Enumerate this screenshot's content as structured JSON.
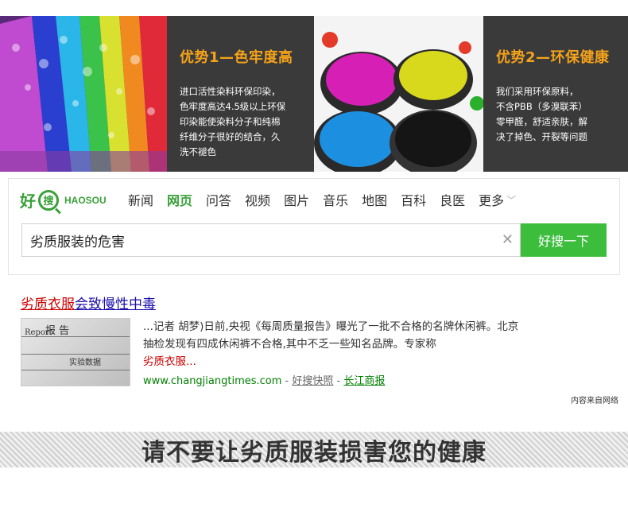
{
  "banner": {
    "panel1": {
      "title": "优势1—色牢度高",
      "body": "进口活性染料环保印染，\n色牢度高达4.5级以上环保\n印染能使染料分子和纯棉\n纤维分子很好的结合，久\n洗不褪色"
    },
    "panel2": {
      "title": "优势2—环保健康",
      "body": "我们采用环保原料，\n不含PBB（多溴联苯）\n零甲醛，舒适亲肤，解\n决了掉色、开裂等问题"
    }
  },
  "search": {
    "logo": {
      "han": "好",
      "circle": "搜",
      "en": "HAOSOU"
    },
    "nav": [
      "新闻",
      "网页",
      "问答",
      "视频",
      "图片",
      "音乐",
      "地图",
      "百科",
      "良医"
    ],
    "nav_active": "网页",
    "nav_more": "更多",
    "query": "劣质服装的危害",
    "button": "好搜一下"
  },
  "result": {
    "title_red": "劣质衣服",
    "title_blue": "会致慢性中毒",
    "thumb_texts": [
      "报  告",
      "Report",
      "实验数据"
    ],
    "snippet": "...记者 胡梦)日前,央视《每周质量报告》曝光了一批不合格的名牌休闲裤。北京抽检发现有四成休闲裤不合格,其中不乏一些知名品牌。专家称",
    "snippet_red": "劣质衣服...",
    "url": "www.changjiangtimes.com",
    "sep1": " - ",
    "cache": "好搜快照",
    "sep2": " - ",
    "source": "长江商报",
    "note": "内容来自网络"
  },
  "slogan": "请不要让劣质服装损害您的健康",
  "colors": {
    "brand_green": "#3cbd3c",
    "title_orange": "#f4a21a",
    "panel_bg": "#3a3a3a"
  }
}
